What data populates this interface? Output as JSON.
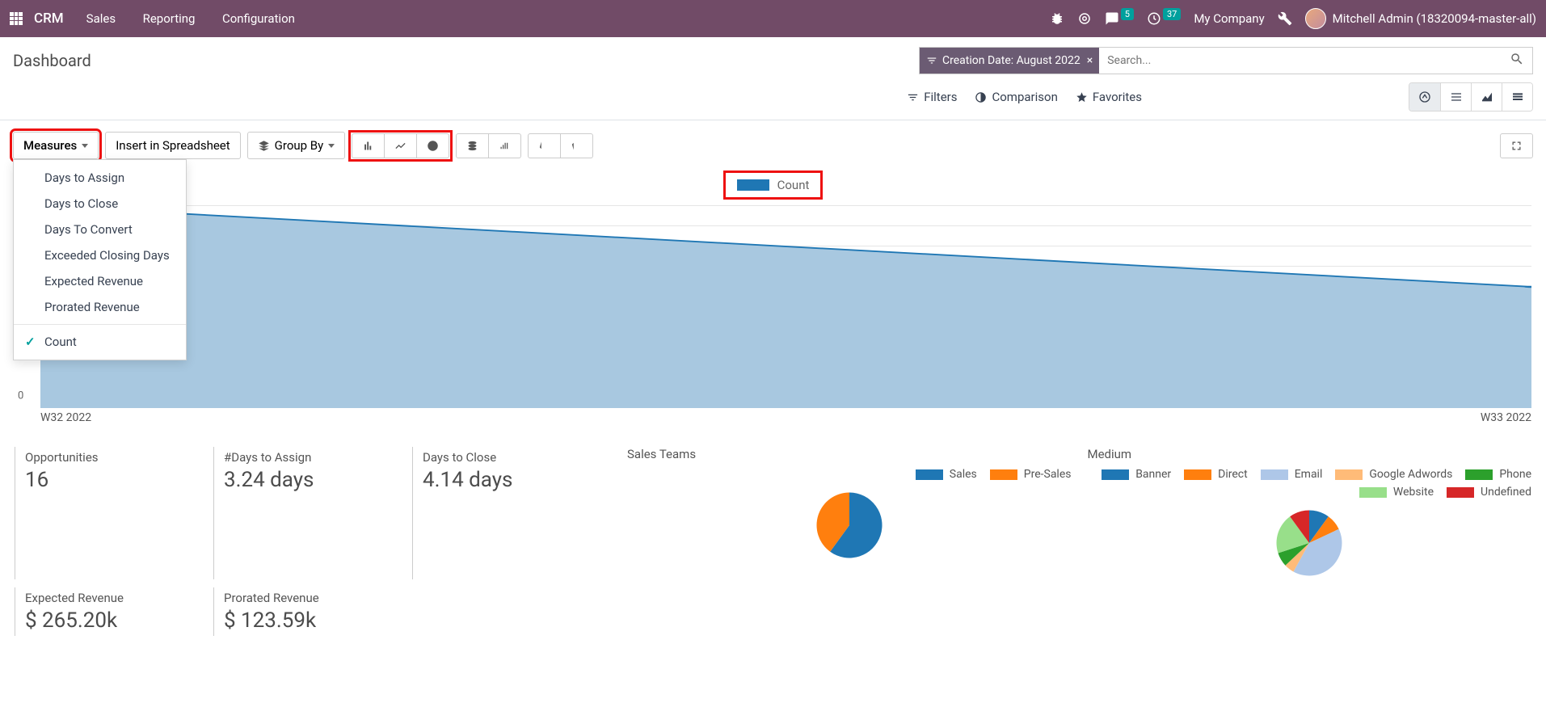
{
  "topnav": {
    "brand": "CRM",
    "menu": [
      "Sales",
      "Reporting",
      "Configuration"
    ],
    "msg_badge": "5",
    "activity_badge": "37",
    "company": "My Company",
    "user": "Mitchell Admin (18320094-master-all)"
  },
  "page": {
    "title": "Dashboard"
  },
  "search": {
    "tag_label": "Creation Date: August 2022",
    "placeholder": "Search...",
    "filters_label": "Filters",
    "comparison_label": "Comparison",
    "favorites_label": "Favorites"
  },
  "toolbar": {
    "measures_label": "Measures",
    "insert_label": "Insert in Spreadsheet",
    "groupby_label": "Group By",
    "measures_menu": [
      "Days to Assign",
      "Days to Close",
      "Days To Convert",
      "Exceeded Closing Days",
      "Expected Revenue",
      "Prorated Revenue"
    ],
    "measures_checked": "Count"
  },
  "chart_data": {
    "type": "area",
    "title": "",
    "legend": [
      "Count"
    ],
    "x": [
      "W32 2022",
      "W33 2022"
    ],
    "values": [
      10,
      6
    ],
    "ylim": [
      0,
      10
    ],
    "yticks": [
      0,
      2
    ],
    "xlabel": "",
    "ylabel": ""
  },
  "kpis": {
    "opportunities": {
      "label": "Opportunities",
      "value": "16"
    },
    "days_assign": {
      "label": "#Days to Assign",
      "value": "3.24 days"
    },
    "days_close": {
      "label": "Days to Close",
      "value": "4.14 days"
    },
    "expected_rev": {
      "label": "Expected Revenue",
      "value": "$ 265.20k"
    },
    "prorated_rev": {
      "label": "Prorated Revenue",
      "value": "$ 123.59k"
    }
  },
  "pies": {
    "sales_teams": {
      "title": "Sales Teams",
      "series": [
        {
          "name": "Sales",
          "color": "#1f77b4",
          "value": 60
        },
        {
          "name": "Pre-Sales",
          "color": "#ff7f0e",
          "value": 40
        }
      ]
    },
    "medium": {
      "title": "Medium",
      "series": [
        {
          "name": "Banner",
          "color": "#1f77b4",
          "value": 10
        },
        {
          "name": "Direct",
          "color": "#ff7f0e",
          "value": 8
        },
        {
          "name": "Email",
          "color": "#aec7e8",
          "value": 40
        },
        {
          "name": "Google Adwords",
          "color": "#ffbb78",
          "value": 5
        },
        {
          "name": "Phone",
          "color": "#2ca02c",
          "value": 7
        },
        {
          "name": "Website",
          "color": "#98df8a",
          "value": 20
        },
        {
          "name": "Undefined",
          "color": "#d62728",
          "value": 10
        }
      ]
    }
  }
}
